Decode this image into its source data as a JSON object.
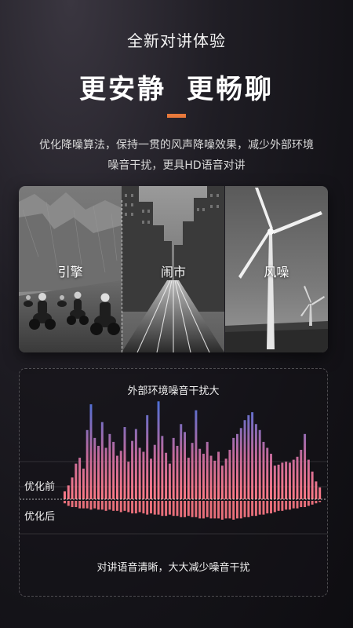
{
  "header": {
    "title": "全新对讲体验",
    "headline_part1": "更安静",
    "headline_part2": "更畅聊",
    "accent_color": "#e8793b"
  },
  "description": {
    "line1": "优化降噪算法，保持一贯的风声降噪效果，减少外部环境",
    "line2": "噪音干扰，更具HD语音对讲"
  },
  "scenes": [
    {
      "label": "引擎",
      "icon": "motorcycle-riders-image"
    },
    {
      "label": "闹市",
      "icon": "city-street-image"
    },
    {
      "label": "风噪",
      "icon": "wind-turbine-image"
    }
  ],
  "chart_data": {
    "type": "bar",
    "title": "外部环境噪音干扰大",
    "caption": "对讲语音清晰，大大减少噪音干扰",
    "series": [
      {
        "name": "优化前",
        "color_top": "#4a6fd8",
        "color_bottom": "#ff7a86",
        "values": [
          8,
          14,
          22,
          36,
          42,
          31,
          70,
          96,
          62,
          54,
          78,
          52,
          66,
          58,
          44,
          49,
          73,
          38,
          59,
          71,
          52,
          48,
          85,
          41,
          55,
          99,
          64,
          47,
          36,
          62,
          54,
          76,
          68,
          42,
          57,
          90,
          51,
          46,
          58,
          44,
          39,
          48,
          34,
          41,
          50,
          62,
          66,
          72,
          80,
          85,
          88,
          76,
          70,
          58,
          52,
          46,
          34,
          35,
          37,
          38,
          37,
          40,
          43,
          50,
          66,
          40,
          28,
          18,
          12
        ]
      },
      {
        "name": "优化后",
        "color": "#ff7a86",
        "values": [
          2,
          4,
          5,
          5,
          6,
          6,
          6,
          7,
          6,
          7,
          7,
          8,
          7,
          8,
          8,
          9,
          8,
          9,
          10,
          10,
          9,
          10,
          11,
          10,
          11,
          11,
          12,
          12,
          11,
          12,
          12,
          13,
          13,
          12,
          13,
          13,
          14,
          14,
          13,
          14,
          14,
          14,
          15,
          14,
          14,
          15,
          14,
          14,
          13,
          13,
          12,
          12,
          11,
          11,
          10,
          10,
          9,
          8,
          8,
          7,
          7,
          6,
          6,
          5,
          5,
          4,
          3,
          2,
          1
        ]
      }
    ]
  }
}
